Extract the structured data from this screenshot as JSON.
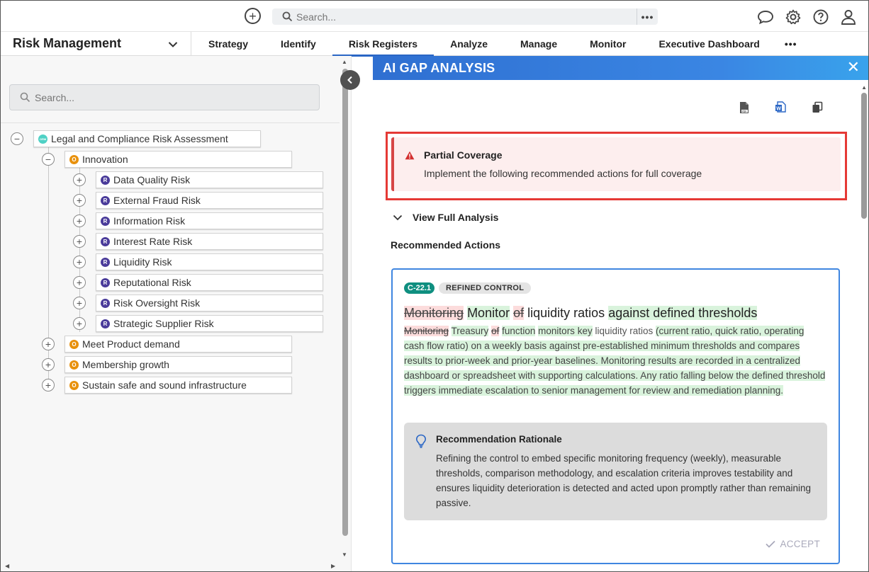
{
  "topbar": {
    "search_placeholder": "Search...",
    "search_more": "•••",
    "icons": [
      "add-icon",
      "search-icon",
      "more-icon",
      "chat-icon",
      "gear-icon",
      "help-icon",
      "user-icon"
    ]
  },
  "app": {
    "name": "Risk Management"
  },
  "nav": {
    "tabs": [
      {
        "label": "Strategy"
      },
      {
        "label": "Identify"
      },
      {
        "label": "Risk Registers",
        "active": true
      },
      {
        "label": "Analyze"
      },
      {
        "label": "Manage"
      },
      {
        "label": "Monitor"
      },
      {
        "label": "Executive Dashboard"
      }
    ],
    "more": "•••"
  },
  "left_panel": {
    "search_placeholder": "Search...",
    "tree": {
      "root": {
        "badge": "ORM",
        "label": "Legal and Compliance Risk Assessment"
      },
      "objectives": [
        {
          "badge": "O",
          "label": "Innovation",
          "expanded": true,
          "risks": [
            {
              "badge": "R",
              "label": "Data Quality Risk"
            },
            {
              "badge": "R",
              "label": "External Fraud Risk"
            },
            {
              "badge": "R",
              "label": "Information Risk"
            },
            {
              "badge": "R",
              "label": "Interest Rate Risk"
            },
            {
              "badge": "R",
              "label": "Liquidity Risk"
            },
            {
              "badge": "R",
              "label": "Reputational Risk"
            },
            {
              "badge": "R",
              "label": "Risk Oversight Risk"
            },
            {
              "badge": "R",
              "label": "Strategic Supplier Risk"
            }
          ]
        },
        {
          "badge": "O",
          "label": "Meet Product demand"
        },
        {
          "badge": "O",
          "label": "Membership growth"
        },
        {
          "badge": "O",
          "label": "Sustain safe and sound infrastructure"
        }
      ]
    }
  },
  "gap_panel": {
    "title": "AI GAP ANALYSIS",
    "export_icons": [
      "pdf-export-icon",
      "word-export-icon",
      "copy-icon"
    ],
    "alert": {
      "title": "Partial Coverage",
      "message": "Implement the following recommended actions for full coverage"
    },
    "view_full": "View Full Analysis",
    "recommended_title": "Recommended Actions",
    "card": {
      "control_id": "C-22.1",
      "control_type": "REFINED CONTROL",
      "title_del_1": "Monitoring",
      "title_ins_1": "Monitor",
      "title_del_2": "of",
      "title_plain": "liquidity ratios",
      "title_ins_2": "against defined thresholds",
      "desc_del_1": "Monitoring",
      "desc_ins_1": "Treasury",
      "desc_del_2": "of",
      "desc_ins_2": "function",
      "desc_ins_3": "monitors key",
      "desc_plain": "liquidity ratios",
      "desc_ins_4": "(current ratio, quick ratio, operating cash flow ratio) on a weekly basis against pre-established minimum thresholds and compares results to prior-week and prior-year baselines. Monitoring results are recorded in a centralized dashboard or spreadsheet with supporting calculations. Any ratio falling below the defined threshold triggers immediate escalation to senior management for review and remediation planning.",
      "rationale_title": "Recommendation Rationale",
      "rationale_body": "Refining the control to embed specific monitoring frequency (weekly), measurable thresholds, comparison methodology, and escalation criteria improves testability and ensures liquidity deterioration is detected and acted upon promptly rather than remaining passive.",
      "accept_label": "ACCEPT"
    }
  },
  "colors": {
    "accent": "#2a66c5",
    "header_gradient_start": "#2f6fd1",
    "alert_border": "#e53935",
    "chip_id": "#0f8f80",
    "insert_bg": "#d9f3dc",
    "delete_bg": "#fcdcdc"
  }
}
